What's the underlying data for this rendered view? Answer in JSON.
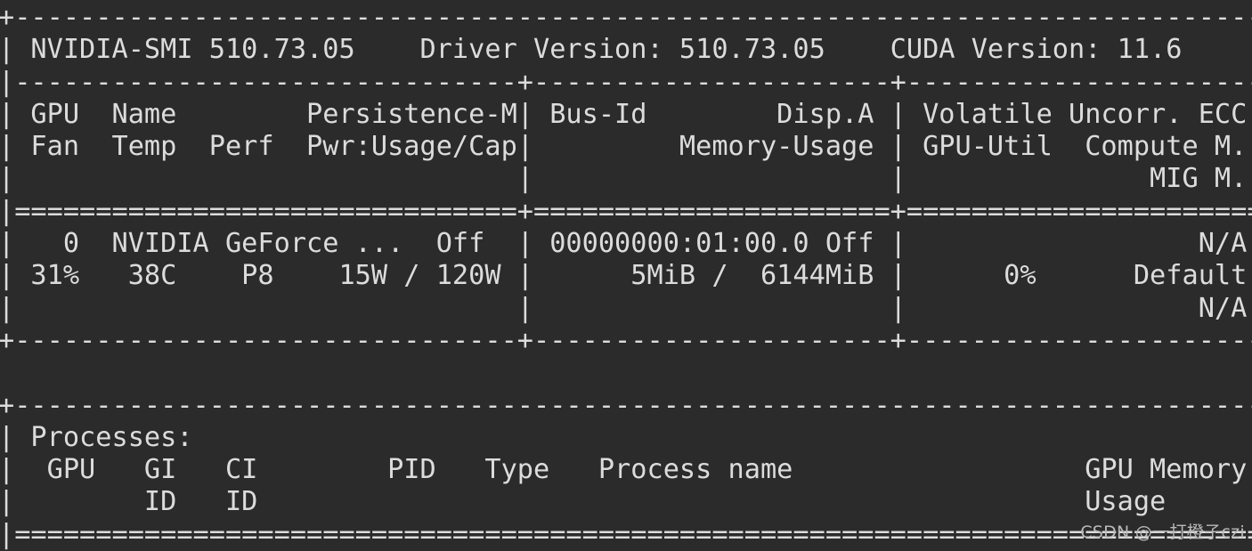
{
  "terminal": {
    "background_color": "#2b2b2b",
    "foreground_color": "#dcdcdc",
    "command": "nvidia-smi",
    "columns": 77,
    "rows": 17
  },
  "header": {
    "smi_label": "NVIDIA-SMI",
    "smi_version": "510.73.05",
    "driver_label": "Driver Version:",
    "driver_version": "510.73.05",
    "cuda_label": "CUDA Version:",
    "cuda_version": "11.6"
  },
  "gpu_table": {
    "header_row_1": [
      "GPU",
      "Name",
      "Persistence-M",
      "Bus-Id",
      "Disp.A",
      "Volatile Uncorr. ECC"
    ],
    "header_row_2": [
      "Fan",
      "Temp",
      "Perf",
      "Pwr:Usage/Cap",
      "Memory-Usage",
      "GPU-Util",
      "Compute M."
    ],
    "header_row_3": [
      "MIG M."
    ],
    "rows": [
      {
        "gpu_index": "0",
        "name": "NVIDIA GeForce ...",
        "persistence_m": "Off",
        "bus_id": "00000000:01:00.0",
        "disp_a": "Off",
        "ecc": "N/A",
        "fan": "31%",
        "temp": "38C",
        "perf": "P8",
        "pwr_usage": "15W",
        "pwr_cap": "120W",
        "memory_used": "5MiB",
        "memory_total": "6144MiB",
        "gpu_util": "0%",
        "compute_mode": "Default",
        "mig_mode": "N/A"
      }
    ]
  },
  "processes_table": {
    "title": "Processes:",
    "header_row_1": [
      "GPU",
      "GI",
      "CI",
      "PID",
      "Type",
      "Process name",
      "GPU Memory"
    ],
    "header_row_2": [
      "ID",
      "ID",
      "Usage"
    ],
    "rows": []
  },
  "watermark": {
    "text": "CSDN @一打橙子czi"
  },
  "lines": [
    "+-----------------------------------------------------------------------------+",
    "| NVIDIA-SMI 510.73.05    Driver Version: 510.73.05    CUDA Version: 11.6     |",
    "|-------------------------------+----------------------+----------------------+",
    "| GPU  Name        Persistence-M| Bus-Id        Disp.A | Volatile Uncorr. ECC |",
    "| Fan  Temp  Perf  Pwr:Usage/Cap|         Memory-Usage | GPU-Util  Compute M. |",
    "|                               |                      |               MIG M. |",
    "|===============================+======================+======================|",
    "|   0  NVIDIA GeForce ...  Off  | 00000000:01:00.0 Off |                  N/A |",
    "| 31%   38C    P8    15W / 120W |      5MiB /  6144MiB |      0%      Default |",
    "|                               |                      |                  N/A |",
    "+-------------------------------+----------------------+----------------------+",
    "                                                                               ",
    "+-----------------------------------------------------------------------------+",
    "| Processes:                                                                  |",
    "|  GPU   GI   CI        PID   Type   Process name                  GPU Memory |",
    "|        ID   ID                                                   Usage      |",
    "|=============================================================================|"
  ]
}
